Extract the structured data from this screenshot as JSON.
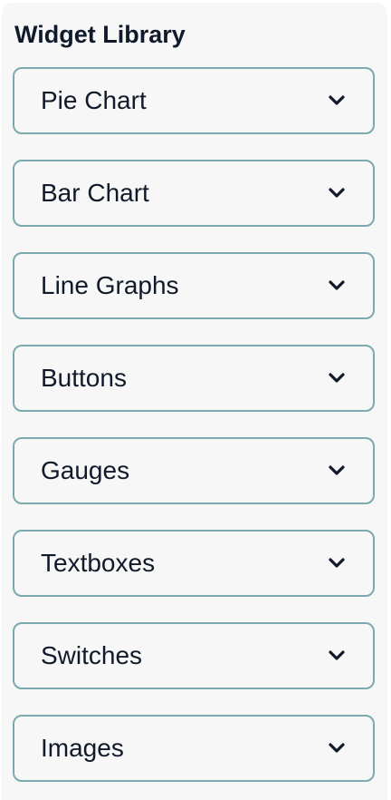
{
  "title": "Widget Library",
  "items": [
    {
      "label": "Pie Chart",
      "icon": "chevron-down-icon"
    },
    {
      "label": "Bar Chart",
      "icon": "chevron-down-icon"
    },
    {
      "label": "Line Graphs",
      "icon": "chevron-down-icon"
    },
    {
      "label": "Buttons",
      "icon": "chevron-down-icon"
    },
    {
      "label": "Gauges",
      "icon": "chevron-down-icon"
    },
    {
      "label": "Textboxes",
      "icon": "chevron-down-icon"
    },
    {
      "label": "Switches",
      "icon": "chevron-down-icon"
    },
    {
      "label": "Images",
      "icon": "chevron-down-icon"
    }
  ],
  "colors": {
    "border": "#7aa9ae",
    "panel": "#f7f7f7",
    "text": "#111a2a"
  }
}
